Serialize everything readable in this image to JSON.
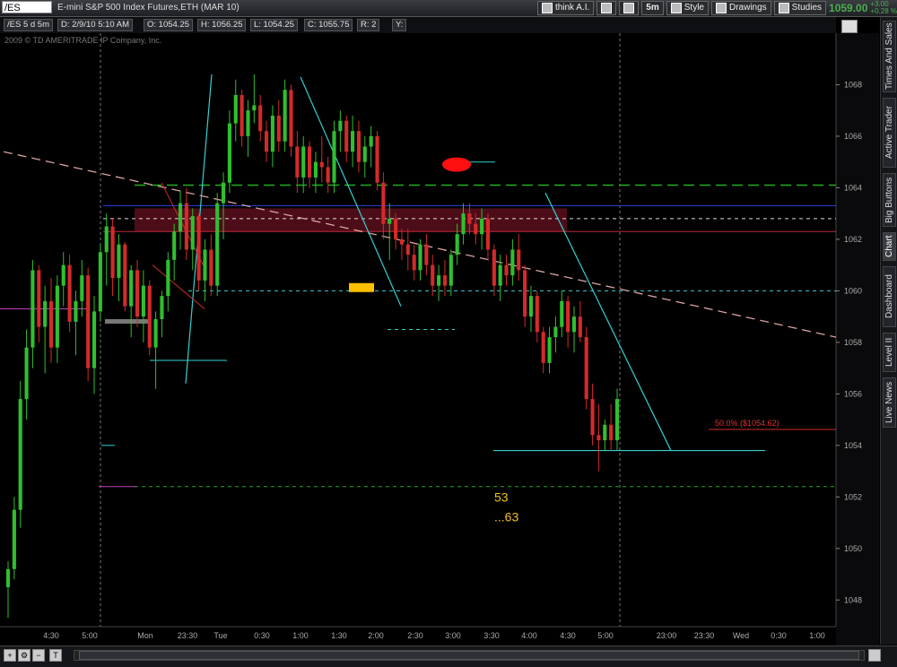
{
  "toolbar": {
    "symbol": "/ES",
    "description": "E-mini S&P 500 Index Futures,ETH (MAR 10)",
    "think_label": "think A.I.",
    "interval": "5m",
    "style_label": "Style",
    "drawings_label": "Drawings",
    "studies_label": "Studies",
    "last_price": "1059.00",
    "change_abs": "+3.00",
    "change_pct": "+0.28 %"
  },
  "info": {
    "period": "/ES 5 d 5m",
    "date": "D: 2/9/10 5:10 AM",
    "open": "O: 1054.25",
    "high": "H: 1056.25",
    "low": "L: 1054.25",
    "close": "C: 1055.75",
    "range": "R: 2",
    "y": "Y:",
    "copyright": "2009 © TD AMERITRADE IP Company, Inc."
  },
  "sidebar": {
    "tabs": [
      "Times And Sales",
      "Active Trader",
      "Big Buttons",
      "Chart",
      "Dashboard",
      "Level II",
      "Live News"
    ],
    "active": "Chart"
  },
  "colors": {
    "up": "#2fbf2f",
    "down": "#d42a2a",
    "bg": "#000000",
    "cyan": "#34d0d0",
    "green_dash": "#1fae1f",
    "pink_dash": "#d9a3a3"
  },
  "chart_data": {
    "type": "candlestick",
    "ylim": [
      1047,
      1070
    ],
    "y_ticks": [
      1048,
      1050,
      1052,
      1054,
      1056,
      1058,
      1060,
      1062,
      1064,
      1066,
      1068
    ],
    "x_tick_labels": [
      "4:30",
      "5:00",
      "Mon",
      "23:30",
      "Tue",
      "0:30",
      "1:00",
      "1:30",
      "2:00",
      "2:30",
      "3:00",
      "3:30",
      "4:00",
      "4:30",
      "5:00",
      "23:00",
      "23:30",
      "Wed",
      "0:30",
      "1:00"
    ],
    "annotations": {
      "fib_label": "50.0%  ($1054.62)",
      "fib_value": 1054.62,
      "note_1": "53",
      "note_2": "...63",
      "h_green_dash": 1064.1,
      "h_cyan_dash": 1060.0,
      "h_green_dash_low": 1052.4,
      "h_white_dash": 1062.8,
      "h_blue": 1063.3,
      "h_red": 1062.3,
      "zone": [
        1062.3,
        1063.2
      ],
      "cyan_support": 1053.8
    },
    "candles": [
      {
        "o": 1048.5,
        "h": 1049.5,
        "l": 1047.3,
        "c": 1049.2
      },
      {
        "o": 1049.2,
        "h": 1052.0,
        "l": 1048.8,
        "c": 1051.5
      },
      {
        "o": 1051.5,
        "h": 1056.5,
        "l": 1050.8,
        "c": 1055.8
      },
      {
        "o": 1055.8,
        "h": 1058.5,
        "l": 1055.0,
        "c": 1057.8
      },
      {
        "o": 1057.8,
        "h": 1061.2,
        "l": 1057.0,
        "c": 1060.8
      },
      {
        "o": 1060.8,
        "h": 1061.0,
        "l": 1058.0,
        "c": 1058.6
      },
      {
        "o": 1058.6,
        "h": 1060.2,
        "l": 1056.8,
        "c": 1059.6
      },
      {
        "o": 1059.6,
        "h": 1060.5,
        "l": 1057.2,
        "c": 1057.8
      },
      {
        "o": 1057.8,
        "h": 1060.6,
        "l": 1057.2,
        "c": 1060.2
      },
      {
        "o": 1060.2,
        "h": 1061.5,
        "l": 1059.4,
        "c": 1061.0
      },
      {
        "o": 1061.0,
        "h": 1061.4,
        "l": 1058.4,
        "c": 1058.8
      },
      {
        "o": 1058.8,
        "h": 1060.0,
        "l": 1057.5,
        "c": 1059.6
      },
      {
        "o": 1059.6,
        "h": 1061.2,
        "l": 1059.0,
        "c": 1060.6
      },
      {
        "o": 1060.6,
        "h": 1060.9,
        "l": 1056.5,
        "c": 1057.0
      },
      {
        "o": 1057.0,
        "h": 1059.8,
        "l": 1056.0,
        "c": 1059.2
      },
      {
        "o": 1059.2,
        "h": 1061.8,
        "l": 1058.8,
        "c": 1061.5
      },
      {
        "o": 1061.5,
        "h": 1063.0,
        "l": 1060.2,
        "c": 1062.5
      },
      {
        "o": 1062.5,
        "h": 1062.8,
        "l": 1059.8,
        "c": 1060.5
      },
      {
        "o": 1060.5,
        "h": 1062.2,
        "l": 1059.6,
        "c": 1061.8
      },
      {
        "o": 1061.8,
        "h": 1061.9,
        "l": 1059.2,
        "c": 1059.4
      },
      {
        "o": 1059.4,
        "h": 1061.0,
        "l": 1058.2,
        "c": 1060.8
      },
      {
        "o": 1060.8,
        "h": 1061.2,
        "l": 1058.6,
        "c": 1059.0
      },
      {
        "o": 1059.0,
        "h": 1060.8,
        "l": 1058.0,
        "c": 1060.2
      },
      {
        "o": 1060.2,
        "h": 1060.4,
        "l": 1057.5,
        "c": 1057.8
      },
      {
        "o": 1057.8,
        "h": 1059.2,
        "l": 1056.2,
        "c": 1058.9
      },
      {
        "o": 1058.9,
        "h": 1060.0,
        "l": 1058.2,
        "c": 1059.8
      },
      {
        "o": 1059.8,
        "h": 1061.5,
        "l": 1059.2,
        "c": 1061.2
      },
      {
        "o": 1061.2,
        "h": 1062.6,
        "l": 1060.4,
        "c": 1062.3
      },
      {
        "o": 1062.3,
        "h": 1063.9,
        "l": 1061.6,
        "c": 1063.4
      },
      {
        "o": 1063.4,
        "h": 1064.0,
        "l": 1061.2,
        "c": 1061.6
      },
      {
        "o": 1061.6,
        "h": 1063.2,
        "l": 1060.8,
        "c": 1062.9
      },
      {
        "o": 1062.9,
        "h": 1063.0,
        "l": 1060.0,
        "c": 1060.4
      },
      {
        "o": 1060.4,
        "h": 1062.0,
        "l": 1059.6,
        "c": 1061.6
      },
      {
        "o": 1061.6,
        "h": 1062.2,
        "l": 1059.8,
        "c": 1060.2
      },
      {
        "o": 1060.2,
        "h": 1063.8,
        "l": 1059.8,
        "c": 1063.4
      },
      {
        "o": 1063.4,
        "h": 1064.6,
        "l": 1062.0,
        "c": 1064.2
      },
      {
        "o": 1064.2,
        "h": 1067.0,
        "l": 1063.8,
        "c": 1066.5
      },
      {
        "o": 1066.5,
        "h": 1068.2,
        "l": 1065.8,
        "c": 1067.6
      },
      {
        "o": 1067.6,
        "h": 1067.8,
        "l": 1065.6,
        "c": 1066.0
      },
      {
        "o": 1066.0,
        "h": 1067.4,
        "l": 1065.2,
        "c": 1067.0
      },
      {
        "o": 1067.0,
        "h": 1068.4,
        "l": 1066.5,
        "c": 1067.2
      },
      {
        "o": 1067.2,
        "h": 1067.6,
        "l": 1065.8,
        "c": 1066.2
      },
      {
        "o": 1066.2,
        "h": 1066.6,
        "l": 1065.0,
        "c": 1065.4
      },
      {
        "o": 1065.4,
        "h": 1067.2,
        "l": 1064.8,
        "c": 1066.8
      },
      {
        "o": 1066.8,
        "h": 1067.4,
        "l": 1065.4,
        "c": 1065.8
      },
      {
        "o": 1065.8,
        "h": 1068.2,
        "l": 1065.4,
        "c": 1067.8
      },
      {
        "o": 1067.8,
        "h": 1068.0,
        "l": 1065.2,
        "c": 1065.6
      },
      {
        "o": 1065.6,
        "h": 1066.2,
        "l": 1063.8,
        "c": 1064.4
      },
      {
        "o": 1064.4,
        "h": 1066.0,
        "l": 1063.8,
        "c": 1065.6
      },
      {
        "o": 1065.6,
        "h": 1065.8,
        "l": 1064.0,
        "c": 1064.4
      },
      {
        "o": 1064.4,
        "h": 1065.4,
        "l": 1063.8,
        "c": 1065.0
      },
      {
        "o": 1065.0,
        "h": 1066.0,
        "l": 1064.2,
        "c": 1064.8
      },
      {
        "o": 1064.8,
        "h": 1065.2,
        "l": 1063.8,
        "c": 1064.2
      },
      {
        "o": 1064.2,
        "h": 1066.6,
        "l": 1063.8,
        "c": 1066.2
      },
      {
        "o": 1066.2,
        "h": 1067.0,
        "l": 1065.4,
        "c": 1066.6
      },
      {
        "o": 1066.6,
        "h": 1066.8,
        "l": 1065.0,
        "c": 1065.4
      },
      {
        "o": 1065.4,
        "h": 1066.8,
        "l": 1064.8,
        "c": 1066.2
      },
      {
        "o": 1066.2,
        "h": 1066.6,
        "l": 1064.6,
        "c": 1065.0
      },
      {
        "o": 1065.0,
        "h": 1066.0,
        "l": 1064.4,
        "c": 1065.6
      },
      {
        "o": 1065.6,
        "h": 1066.4,
        "l": 1064.8,
        "c": 1066.0
      },
      {
        "o": 1066.0,
        "h": 1066.2,
        "l": 1063.9,
        "c": 1064.2
      },
      {
        "o": 1064.2,
        "h": 1064.6,
        "l": 1062.0,
        "c": 1062.6
      },
      {
        "o": 1062.6,
        "h": 1063.4,
        "l": 1061.2,
        "c": 1062.8
      },
      {
        "o": 1062.8,
        "h": 1063.0,
        "l": 1061.6,
        "c": 1062.0
      },
      {
        "o": 1062.0,
        "h": 1062.4,
        "l": 1061.2,
        "c": 1061.8
      },
      {
        "o": 1061.8,
        "h": 1062.4,
        "l": 1060.8,
        "c": 1061.4
      },
      {
        "o": 1061.4,
        "h": 1061.8,
        "l": 1060.4,
        "c": 1060.8
      },
      {
        "o": 1060.8,
        "h": 1062.0,
        "l": 1060.4,
        "c": 1061.8
      },
      {
        "o": 1061.8,
        "h": 1062.2,
        "l": 1060.6,
        "c": 1061.0
      },
      {
        "o": 1061.0,
        "h": 1061.4,
        "l": 1059.8,
        "c": 1060.2
      },
      {
        "o": 1060.2,
        "h": 1061.0,
        "l": 1059.6,
        "c": 1060.6
      },
      {
        "o": 1060.6,
        "h": 1061.2,
        "l": 1059.8,
        "c": 1060.2
      },
      {
        "o": 1060.2,
        "h": 1061.6,
        "l": 1059.8,
        "c": 1061.4
      },
      {
        "o": 1061.4,
        "h": 1062.6,
        "l": 1061.0,
        "c": 1062.2
      },
      {
        "o": 1062.2,
        "h": 1063.4,
        "l": 1061.8,
        "c": 1063.0
      },
      {
        "o": 1063.0,
        "h": 1063.4,
        "l": 1062.2,
        "c": 1062.6
      },
      {
        "o": 1062.6,
        "h": 1063.0,
        "l": 1061.8,
        "c": 1062.2
      },
      {
        "o": 1062.2,
        "h": 1063.2,
        "l": 1061.6,
        "c": 1062.8
      },
      {
        "o": 1062.8,
        "h": 1063.0,
        "l": 1061.2,
        "c": 1061.6
      },
      {
        "o": 1061.6,
        "h": 1061.8,
        "l": 1059.8,
        "c": 1060.2
      },
      {
        "o": 1060.2,
        "h": 1061.4,
        "l": 1059.6,
        "c": 1061.0
      },
      {
        "o": 1061.0,
        "h": 1061.4,
        "l": 1060.2,
        "c": 1060.6
      },
      {
        "o": 1060.6,
        "h": 1062.0,
        "l": 1060.2,
        "c": 1061.6
      },
      {
        "o": 1061.6,
        "h": 1062.2,
        "l": 1060.4,
        "c": 1060.8
      },
      {
        "o": 1060.8,
        "h": 1061.0,
        "l": 1058.6,
        "c": 1059.0
      },
      {
        "o": 1059.0,
        "h": 1060.2,
        "l": 1058.4,
        "c": 1059.8
      },
      {
        "o": 1059.8,
        "h": 1060.0,
        "l": 1058.0,
        "c": 1058.4
      },
      {
        "o": 1058.4,
        "h": 1058.6,
        "l": 1056.8,
        "c": 1057.2
      },
      {
        "o": 1057.2,
        "h": 1058.6,
        "l": 1056.8,
        "c": 1058.2
      },
      {
        "o": 1058.2,
        "h": 1059.0,
        "l": 1057.6,
        "c": 1058.6
      },
      {
        "o": 1058.6,
        "h": 1060.0,
        "l": 1058.2,
        "c": 1059.6
      },
      {
        "o": 1059.6,
        "h": 1059.8,
        "l": 1057.8,
        "c": 1058.4
      },
      {
        "o": 1058.4,
        "h": 1059.4,
        "l": 1057.6,
        "c": 1059.0
      },
      {
        "o": 1059.0,
        "h": 1059.6,
        "l": 1058.0,
        "c": 1058.2
      },
      {
        "o": 1058.2,
        "h": 1058.6,
        "l": 1055.4,
        "c": 1055.8
      },
      {
        "o": 1055.8,
        "h": 1056.4,
        "l": 1054.0,
        "c": 1054.4
      },
      {
        "o": 1054.4,
        "h": 1055.6,
        "l": 1053.0,
        "c": 1054.2
      },
      {
        "o": 1054.2,
        "h": 1055.0,
        "l": 1053.8,
        "c": 1054.8
      },
      {
        "o": 1054.8,
        "h": 1055.6,
        "l": 1053.8,
        "c": 1054.2
      },
      {
        "o": 1054.2,
        "h": 1056.2,
        "l": 1053.8,
        "c": 1055.8
      }
    ]
  }
}
